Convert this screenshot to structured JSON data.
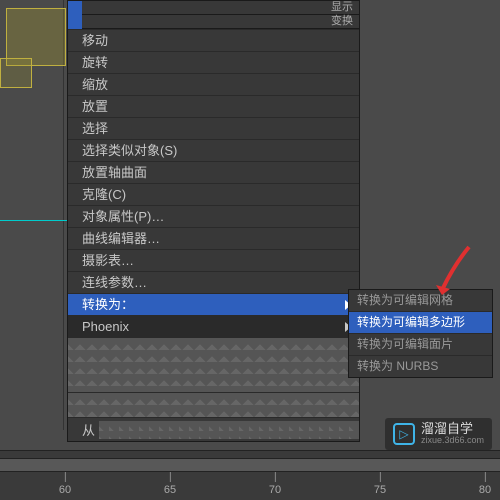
{
  "header": {
    "top_right_1": "显示",
    "top_right_2": "变换"
  },
  "menu": {
    "items": [
      "移动",
      "旋转",
      "缩放",
      "放置",
      "选择",
      "选择类似对象(S)",
      "放置轴曲面",
      "克隆(C)",
      "对象属性(P)…",
      "曲线编辑器…",
      "摄影表…",
      "连线参数…",
      "转换为：",
      "Phoenix",
      "从"
    ],
    "highlighted_index": 12
  },
  "submenu": {
    "items": [
      "转换为可编辑网格",
      "转换为可编辑多边形",
      "转换为可编辑面片",
      "转换为 NURBS"
    ],
    "highlighted_index": 1
  },
  "timeline": {
    "ticks": [
      {
        "label": "60",
        "pos": 65
      },
      {
        "label": "65",
        "pos": 170
      },
      {
        "label": "70",
        "pos": 275
      },
      {
        "label": "75",
        "pos": 380
      },
      {
        "label": "80",
        "pos": 485
      }
    ]
  },
  "watermark": {
    "cn": "溜溜自学",
    "en": "zixue.3d66.com",
    "icon": "▷"
  }
}
